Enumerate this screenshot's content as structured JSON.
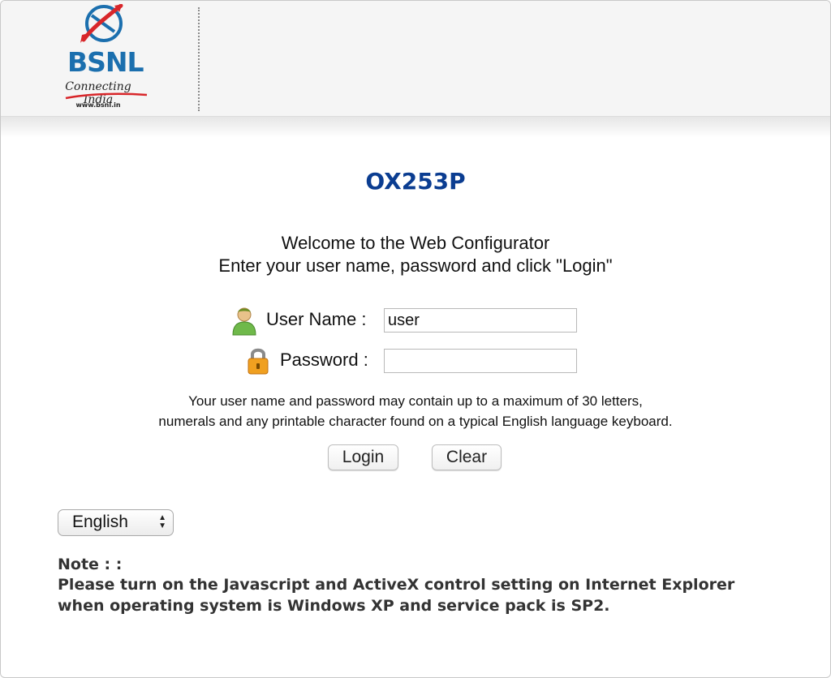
{
  "brand": {
    "name": "BSNL",
    "tagline": "Connecting India",
    "url_text": "www.bsnl.in",
    "colors": {
      "logo_blue": "#1b6fae",
      "logo_red": "#d8262a",
      "model_blue": "#0b3d91"
    }
  },
  "page": {
    "model": "OX253P",
    "welcome_line1": "Welcome to the Web Configurator",
    "welcome_line2": "Enter your user name, password and click \"Login\""
  },
  "form": {
    "username": {
      "label": "User Name :",
      "value": "user",
      "icon": "user-icon"
    },
    "password": {
      "label": "Password :",
      "value": "",
      "icon": "lock-icon"
    },
    "hint_line1": "Your user name and password may contain up to a maximum of 30 letters,",
    "hint_line2": "numerals and any printable character found on a typical English language keyboard.",
    "login_label": "Login",
    "clear_label": "Clear"
  },
  "language": {
    "selected": "English",
    "icon": "updown-arrows-icon"
  },
  "note": {
    "title": "Note : :",
    "line1": "Please turn on the Javascript and ActiveX control setting on Internet Explorer",
    "line2": "when operating system is Windows XP and service pack is SP2."
  }
}
